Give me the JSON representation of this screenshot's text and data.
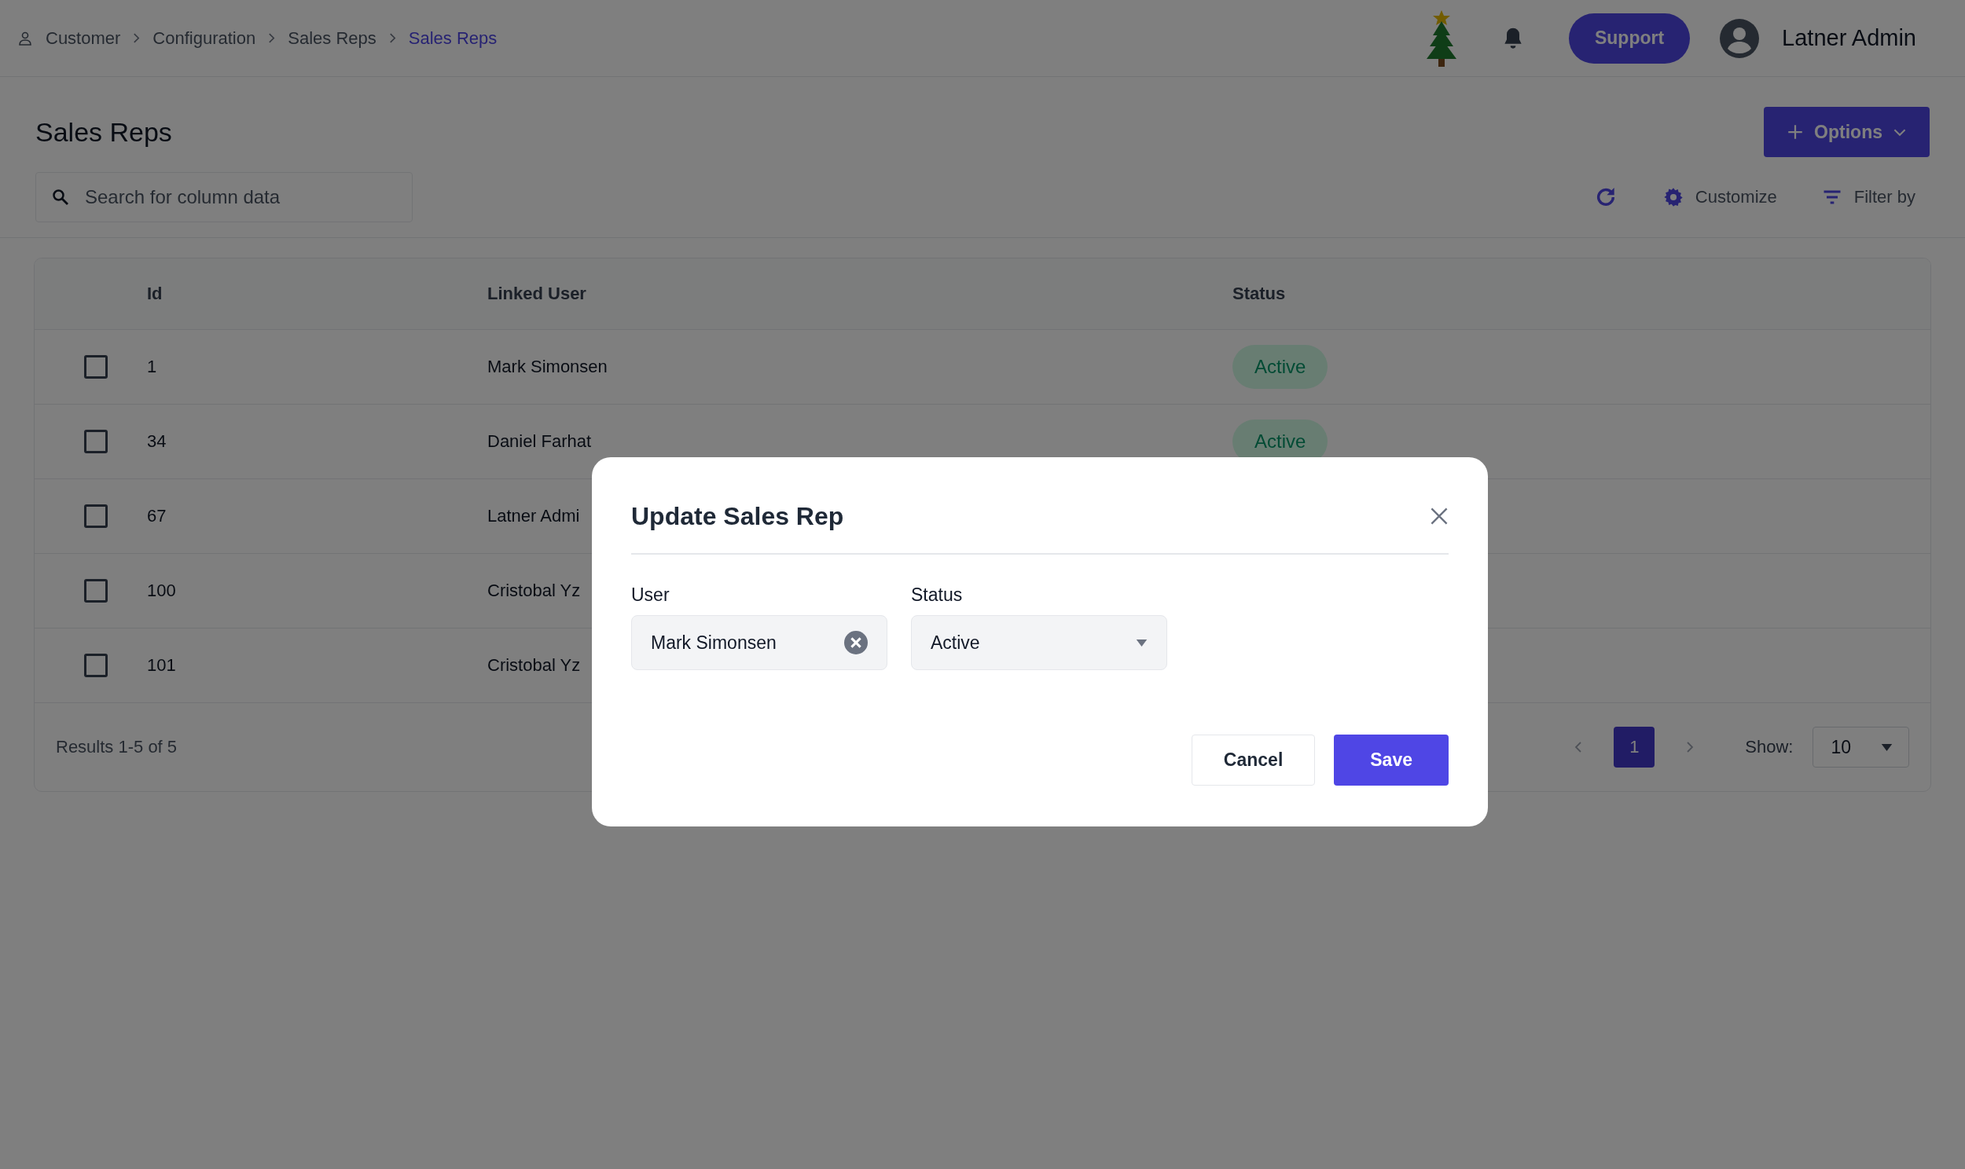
{
  "breadcrumb": [
    {
      "label": "Customer",
      "selected": false
    },
    {
      "label": "Configuration",
      "selected": false
    },
    {
      "label": "Sales Reps",
      "selected": false
    },
    {
      "label": "Sales Reps",
      "selected": true
    }
  ],
  "support_button": "Support",
  "user": {
    "name": "Latner Admin"
  },
  "page_title": "Sales Reps",
  "options_button": "Options",
  "search": {
    "placeholder": "Search for column data"
  },
  "toolbar": [
    {
      "kind": "refresh"
    },
    {
      "kind": "customize",
      "label": "Customize"
    },
    {
      "kind": "filter",
      "label": "Filter by"
    }
  ],
  "table": {
    "columns": [
      "Id",
      "Linked User",
      "Status"
    ],
    "rows": [
      {
        "checked": false,
        "id": "1",
        "linked_user": "Mark Simonsen",
        "status": "Active"
      },
      {
        "checked": false,
        "id": "34",
        "linked_user": "Daniel Farhat",
        "status": "Active"
      },
      {
        "checked": false,
        "id": "67",
        "linked_user": "Latner Admi"
      },
      {
        "checked": false,
        "id": "100",
        "linked_user": "Cristobal Yz"
      },
      {
        "checked": false,
        "id": "101",
        "linked_user": "Cristobal Yz"
      }
    ]
  },
  "footer": {
    "results": "Results 1-5 of 5",
    "pages": [
      {
        "label": "1",
        "selected": true
      }
    ],
    "show_label": "Show:",
    "page_size": "10"
  },
  "modal": {
    "title": "Update Sales Rep",
    "fields": [
      {
        "kind": "clearable",
        "label": "User",
        "value": "Mark Simonsen"
      },
      {
        "kind": "select",
        "label": "Status",
        "value": "Active"
      }
    ],
    "buttons": [
      {
        "kind": "secondary",
        "label": "Cancel"
      },
      {
        "kind": "primary",
        "label": "Save"
      }
    ]
  }
}
